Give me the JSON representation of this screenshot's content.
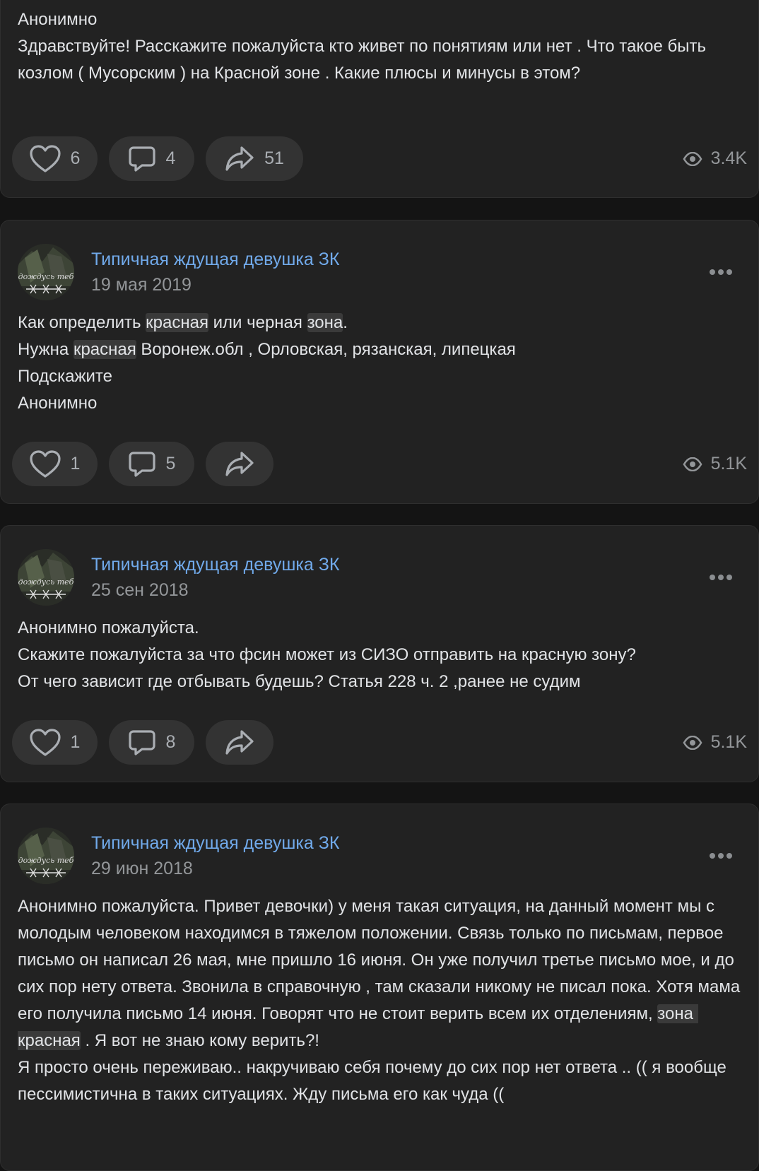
{
  "posts": [
    {
      "paragraphs": [
        [
          {
            "t": "Анонимно"
          }
        ],
        [
          {
            "t": "Здравствуйте! Расскажите пожалуйста кто живет по понятиям или нет . Что такое быть козлом ( Мусорским ) на Красной зоне . Какие плюсы и минусы в этом?"
          }
        ]
      ],
      "likes": "6",
      "comments": "4",
      "shares": "51",
      "views": "3.4K"
    },
    {
      "author": "Типичная ждущая девушка ЗК",
      "date": "19 мая 2019",
      "avatar_text": "дождусь теб",
      "paragraphs": [
        [
          {
            "t": "Как определить "
          },
          {
            "t": "красная",
            "hl": true
          },
          {
            "t": " или черная "
          },
          {
            "t": "зона",
            "hl": true
          },
          {
            "t": "."
          }
        ],
        [
          {
            "t": "Нужна "
          },
          {
            "t": "красная",
            "hl": true
          },
          {
            "t": " Воронеж.обл , Орловская, рязанская, липецкая"
          }
        ],
        [
          {
            "t": "Подскажите"
          }
        ],
        [
          {
            "t": "Анонимно"
          }
        ]
      ],
      "likes": "1",
      "comments": "5",
      "shares": "",
      "views": "5.1K"
    },
    {
      "author": "Типичная ждущая девушка ЗК",
      "date": "25 сен 2018",
      "avatar_text": "дождусь теб",
      "paragraphs": [
        [
          {
            "t": "Анонимно пожалуйста."
          }
        ],
        [
          {
            "t": "Скажите пожалуйста за что фсин может из СИЗО отправить на красную зону?"
          }
        ],
        [
          {
            "t": "От чего зависит где отбывать будешь? Статья 228 ч. 2 ,ранее не судим"
          }
        ]
      ],
      "likes": "1",
      "comments": "8",
      "shares": "",
      "views": "5.1K"
    },
    {
      "author": "Типичная ждущая девушка ЗК",
      "date": "29 июн 2018",
      "avatar_text": "дождусь теб",
      "paragraphs": [
        [
          {
            "t": "Анонимно пожалуйста. Привет девочки) у меня такая ситуация, на данный момент мы с молодым человеком находимся в тяжелом положении. Связь только по письмам, первое письмо он написал 26 мая, мне пришло 16 июня. Он уже получил третье письмо мое, и до сих пор нету ответа. Звонила в справочную , там сказали никому не писал пока. Хотя мама его получила письмо 14 июня. Говорят что не стоит верить всем их отделениям, "
          },
          {
            "t": "зона красная",
            "hl": true
          },
          {
            "t": " . Я вот не знаю кому верить?!"
          }
        ],
        [
          {
            "t": "Я просто очень переживаю.. накручиваю себя почему до сих пор нет ответа .. (( я вообще пессимистична в таких ситуациях. Жду письма его как чуда (("
          }
        ]
      ]
    }
  ],
  "colors": {
    "bg": "#141414",
    "card": "#222222",
    "pill": "#333333",
    "author": "#71aaeb",
    "muted": "#939699"
  },
  "icons": [
    "heart-icon",
    "comment-icon",
    "share-icon",
    "eye-icon",
    "more-icon"
  ]
}
